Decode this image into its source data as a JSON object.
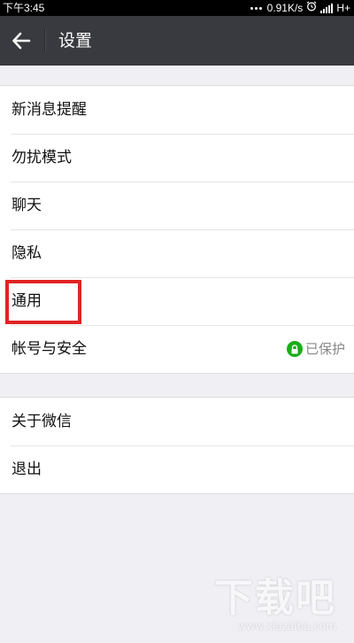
{
  "status_bar": {
    "time": "下午3:45",
    "speed": "0.91K/s",
    "network": "H+"
  },
  "header": {
    "title": "设置"
  },
  "menu": {
    "group1": [
      {
        "label": "新消息提醒"
      },
      {
        "label": "勿扰模式"
      },
      {
        "label": "聊天"
      },
      {
        "label": "隐私"
      },
      {
        "label": "通用"
      },
      {
        "label": "帐号与安全",
        "status": "已保护"
      }
    ],
    "group2": [
      {
        "label": "关于微信"
      },
      {
        "label": "退出"
      }
    ]
  },
  "watermark": {
    "mark": "下载吧",
    "url": "www.xiazaiba.com"
  },
  "colors": {
    "header_bg": "#393a3f",
    "page_bg": "#efeff4",
    "accent_green": "#1aad19",
    "highlight_red": "#e02424"
  },
  "icons": {
    "back": "arrow-left-icon",
    "lock": "lock-icon",
    "alarm": "alarm-clock-icon",
    "signal": "signal-bars-icon"
  }
}
